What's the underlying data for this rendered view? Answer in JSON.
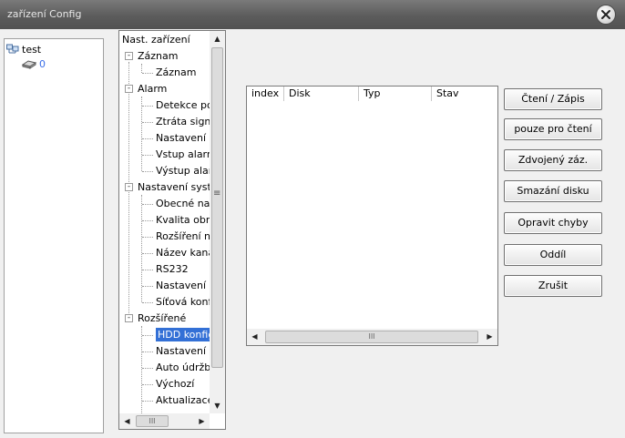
{
  "window": {
    "title": "zařízení Config"
  },
  "devices": {
    "root": "test",
    "child": "0"
  },
  "tree": {
    "items": [
      {
        "label": "Nast. zařízení",
        "level": 0
      },
      {
        "label": "Záznam",
        "level": 1,
        "expander": "-"
      },
      {
        "label": "Záznam",
        "level": 2
      },
      {
        "label": "Alarm",
        "level": 1,
        "expander": "-"
      },
      {
        "label": "Detekce po",
        "level": 2
      },
      {
        "label": "Ztráta signá",
        "level": 2
      },
      {
        "label": "Nastavení p",
        "level": 2
      },
      {
        "label": "Vstup alarm",
        "level": 2
      },
      {
        "label": "Výstup alar",
        "level": 2
      },
      {
        "label": "Nastavení syst",
        "level": 1,
        "expander": "-"
      },
      {
        "label": "Obecné na",
        "level": 2
      },
      {
        "label": "Kvalita obra",
        "level": 2
      },
      {
        "label": "Rozšíření n",
        "level": 2
      },
      {
        "label": "Název kana",
        "level": 2
      },
      {
        "label": "RS232",
        "level": 2
      },
      {
        "label": "Nastavení l",
        "level": 2
      },
      {
        "label": "Síťová konf",
        "level": 2
      },
      {
        "label": "Rozšířené",
        "level": 1,
        "expander": "-"
      },
      {
        "label": "HDD konfig",
        "level": 2,
        "selected": true
      },
      {
        "label": "Nastavení u",
        "level": 2
      },
      {
        "label": "Auto údržb",
        "level": 2
      },
      {
        "label": "Výchozí",
        "level": 2
      },
      {
        "label": "Aktualizace",
        "level": 2
      }
    ],
    "scroll_mid_glyph": "≡"
  },
  "table": {
    "columns": [
      "index",
      "Disk",
      "Typ",
      "Stav"
    ],
    "rows": [],
    "scroll_grip": "III"
  },
  "buttons": [
    "Čtení / Zápis",
    "pouze pro čtení",
    "Zdvojený záz.",
    "Smazání disku",
    "Opravit chyby",
    "Oddíl",
    "Zrušit"
  ]
}
